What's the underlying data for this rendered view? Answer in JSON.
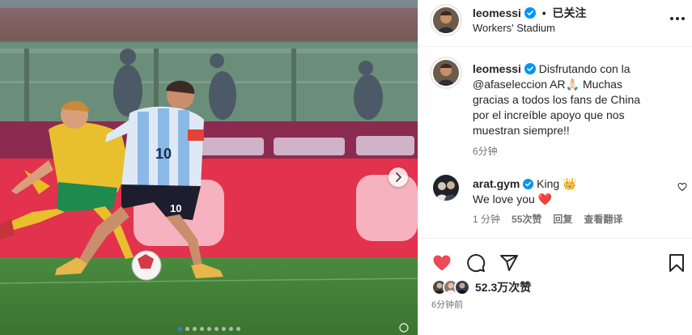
{
  "post": {
    "username": "leomessi",
    "separator": "•",
    "follow_state": "已关注",
    "location": "Workers' Stadium",
    "caption_lines": [
      "Disfrutando con la",
      "@afaseleccion",
      "AR🙏🏻 Muchas",
      "gracias a todos los fans de China",
      "por el increíble apoyo que nos",
      "muestran siempre!!"
    ],
    "caption_time": "6分钟",
    "likes": "52.3万次赞",
    "time_ago": "6分钟前"
  },
  "comment": {
    "username": "arat.gym",
    "line1_text": "King 👑",
    "line2_text": "We love you ❤️",
    "time": "1 分钟",
    "likes": "55次赞",
    "reply": "回复",
    "translate": "查看翻译"
  },
  "carousel": {
    "slides": 9,
    "active_index": 0
  },
  "colors": {
    "like_red": "#ed4956",
    "verified_blue": "#0095f6",
    "accent_dot": "#2f7bf5"
  },
  "icons": [
    "verified-icon",
    "more-options-icon",
    "like-heart-icon",
    "comment-icon",
    "share-icon",
    "save-bookmark-icon",
    "next-arrow-icon"
  ]
}
